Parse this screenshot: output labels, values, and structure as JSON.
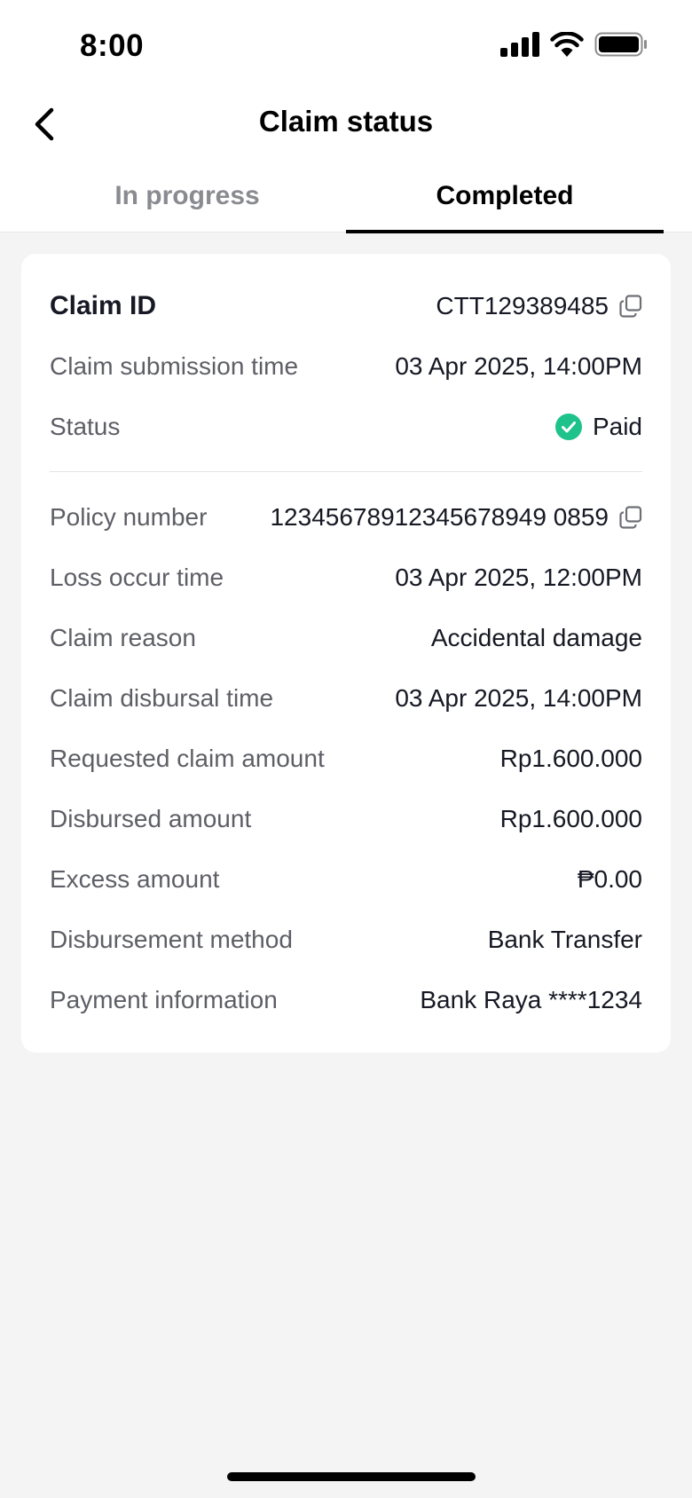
{
  "status_bar": {
    "time": "8:00"
  },
  "nav": {
    "title": "Claim status"
  },
  "tabs": [
    {
      "label": "In progress",
      "active": false
    },
    {
      "label": "Completed",
      "active": true
    }
  ],
  "claim": {
    "claim_id": {
      "label": "Claim ID",
      "value": "CTT129389485"
    },
    "submission_time": {
      "label": "Claim submission time",
      "value": "03 Apr 2025, 14:00PM"
    },
    "status": {
      "label": "Status",
      "value": "Paid"
    },
    "policy_number": {
      "label": "Policy number",
      "value": "12345678912345678949 0859"
    },
    "loss_occur_time": {
      "label": "Loss occur time",
      "value": "03 Apr 2025, 12:00PM"
    },
    "claim_reason": {
      "label": "Claim reason",
      "value": "Accidental damage"
    },
    "disbursal_time": {
      "label": "Claim disbursal time",
      "value": "03 Apr 2025, 14:00PM"
    },
    "requested_amount": {
      "label": "Requested claim amount",
      "value": "Rp1.600.000"
    },
    "disbursed_amount": {
      "label": "Disbursed amount",
      "value": "Rp1.600.000"
    },
    "excess_amount": {
      "label": "Excess amount",
      "value": "₱0.00"
    },
    "disbursement_method": {
      "label": "Disbursement method",
      "value": "Bank Transfer"
    },
    "payment_information": {
      "label": "Payment information",
      "value": "Bank Raya ****1234"
    }
  },
  "colors": {
    "paid_green": "#1ec28b",
    "active_tab": "#000000",
    "inactive_tab": "#8a8b91"
  }
}
